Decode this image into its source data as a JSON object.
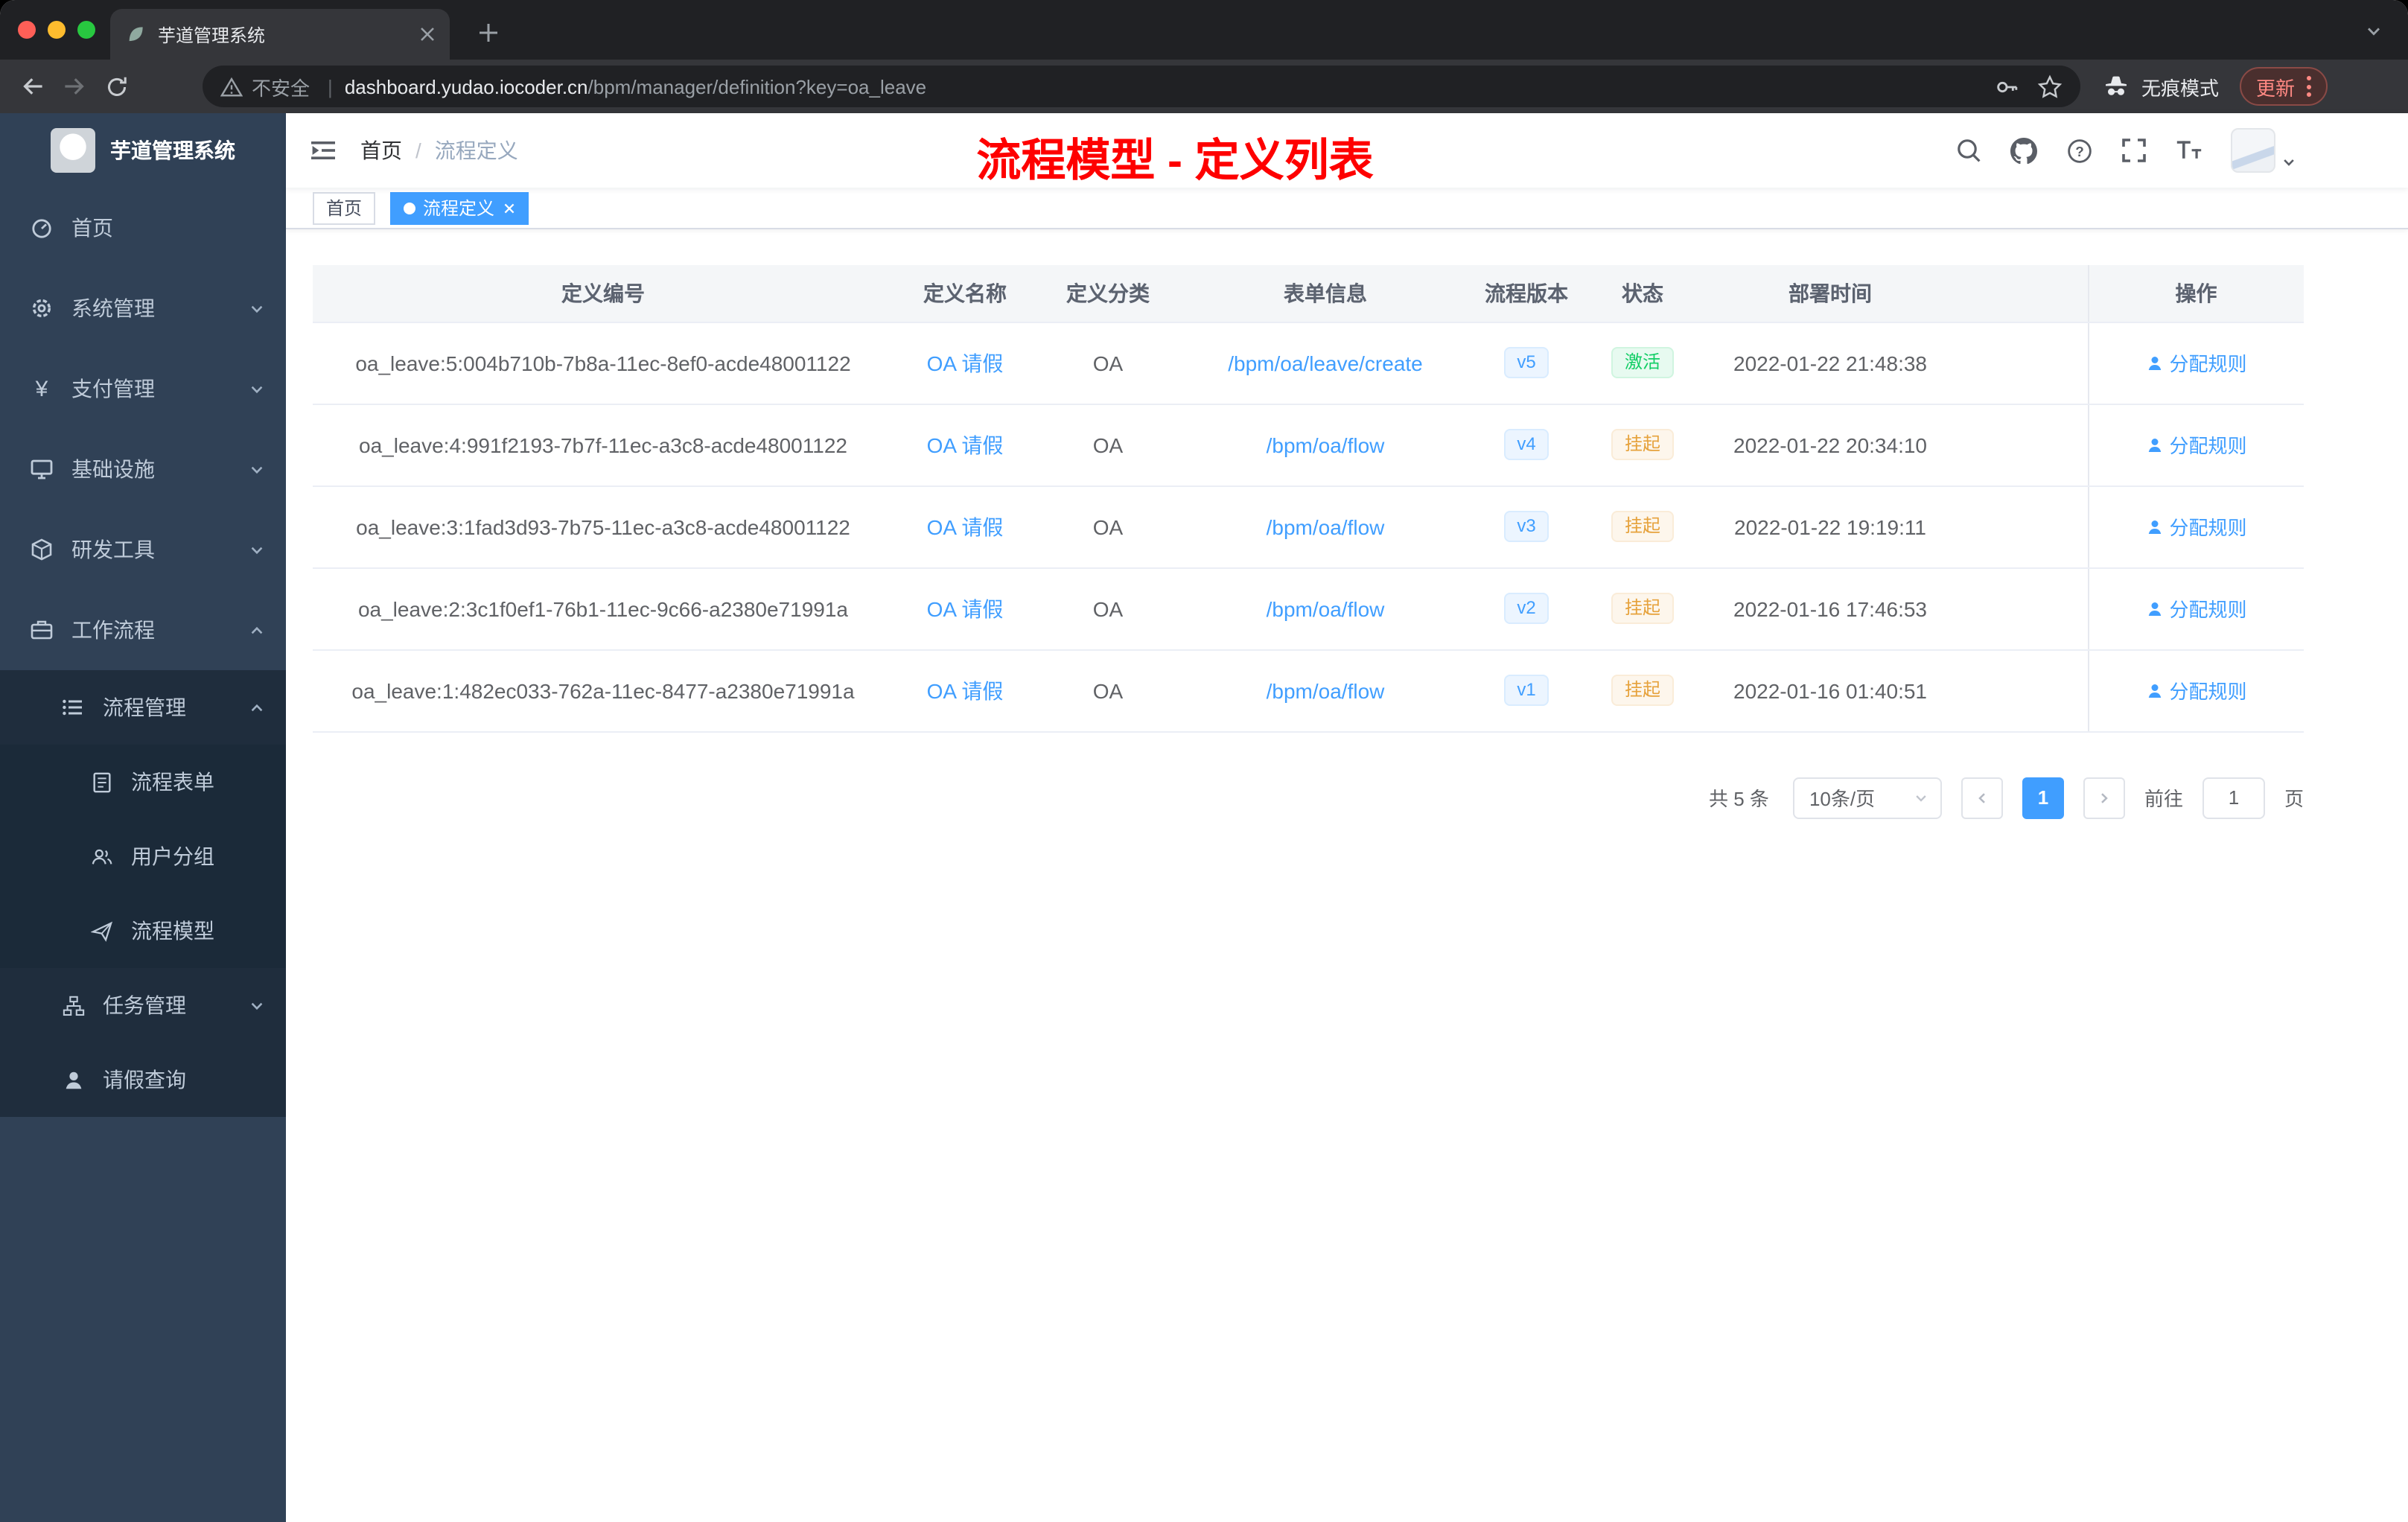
{
  "browser": {
    "tab_title": "芋道管理系统",
    "security_text": "不安全",
    "url_host": "dashboard.yudao.iocoder.cn",
    "url_path": "/bpm/manager/definition?key=oa_leave",
    "incognito_label": "无痕模式",
    "update_label": "更新"
  },
  "sidebar": {
    "logo_title": "芋道管理系统",
    "items": [
      {
        "label": "首页"
      },
      {
        "label": "系统管理",
        "arrow": "down"
      },
      {
        "label": "支付管理",
        "arrow": "down"
      },
      {
        "label": "基础设施",
        "arrow": "down"
      },
      {
        "label": "研发工具",
        "arrow": "down"
      },
      {
        "label": "工作流程",
        "arrow": "up"
      },
      {
        "label": "流程管理",
        "arrow": "up"
      },
      {
        "label": "流程表单"
      },
      {
        "label": "用户分组"
      },
      {
        "label": "流程模型"
      },
      {
        "label": "任务管理",
        "arrow": "down"
      },
      {
        "label": "请假查询"
      }
    ]
  },
  "navbar": {
    "breadcrumb": [
      "首页",
      "流程定义"
    ],
    "breadcrumb_separator": "/",
    "banner": "流程模型 - 定义列表"
  },
  "tags": [
    {
      "label": "首页"
    },
    {
      "label": "流程定义"
    }
  ],
  "table": {
    "columns": [
      "定义编号",
      "定义名称",
      "定义分类",
      "表单信息",
      "流程版本",
      "状态",
      "部署时间",
      "操作"
    ],
    "rows": [
      {
        "id": "oa_leave:5:004b710b-7b8a-11ec-8ef0-acde48001122",
        "name": "OA 请假",
        "category": "OA",
        "form": "/bpm/oa/leave/create",
        "version": "v5",
        "status": "激活",
        "status_type": "success",
        "deploy_time": "2022-01-22 21:48:38",
        "action": "分配规则"
      },
      {
        "id": "oa_leave:4:991f2193-7b7f-11ec-a3c8-acde48001122",
        "name": "OA 请假",
        "category": "OA",
        "form": "/bpm/oa/flow",
        "version": "v4",
        "status": "挂起",
        "status_type": "warning",
        "deploy_time": "2022-01-22 20:34:10",
        "action": "分配规则"
      },
      {
        "id": "oa_leave:3:1fad3d93-7b75-11ec-a3c8-acde48001122",
        "name": "OA 请假",
        "category": "OA",
        "form": "/bpm/oa/flow",
        "version": "v3",
        "status": "挂起",
        "status_type": "warning",
        "deploy_time": "2022-01-22 19:19:11",
        "action": "分配规则"
      },
      {
        "id": "oa_leave:2:3c1f0ef1-76b1-11ec-9c66-a2380e71991a",
        "name": "OA 请假",
        "category": "OA",
        "form": "/bpm/oa/flow",
        "version": "v2",
        "status": "挂起",
        "status_type": "warning",
        "deploy_time": "2022-01-16 17:46:53",
        "action": "分配规则"
      },
      {
        "id": "oa_leave:1:482ec033-762a-11ec-8477-a2380e71991a",
        "name": "OA 请假",
        "category": "OA",
        "form": "/bpm/oa/flow",
        "version": "v1",
        "status": "挂起",
        "status_type": "warning",
        "deploy_time": "2022-01-16 01:40:51",
        "action": "分配规则"
      }
    ]
  },
  "pagination": {
    "total": "共 5 条",
    "page_size": "10条/页",
    "current_page": "1",
    "goto_label": "前往",
    "goto_value": "1",
    "page_unit": "页"
  },
  "colors": {
    "accent_blue": "#409eff",
    "banner_red": "#fe0000",
    "success_green": "#13ce66",
    "warning_orange": "#e6a23c",
    "sidebar_bg": "#304156"
  }
}
